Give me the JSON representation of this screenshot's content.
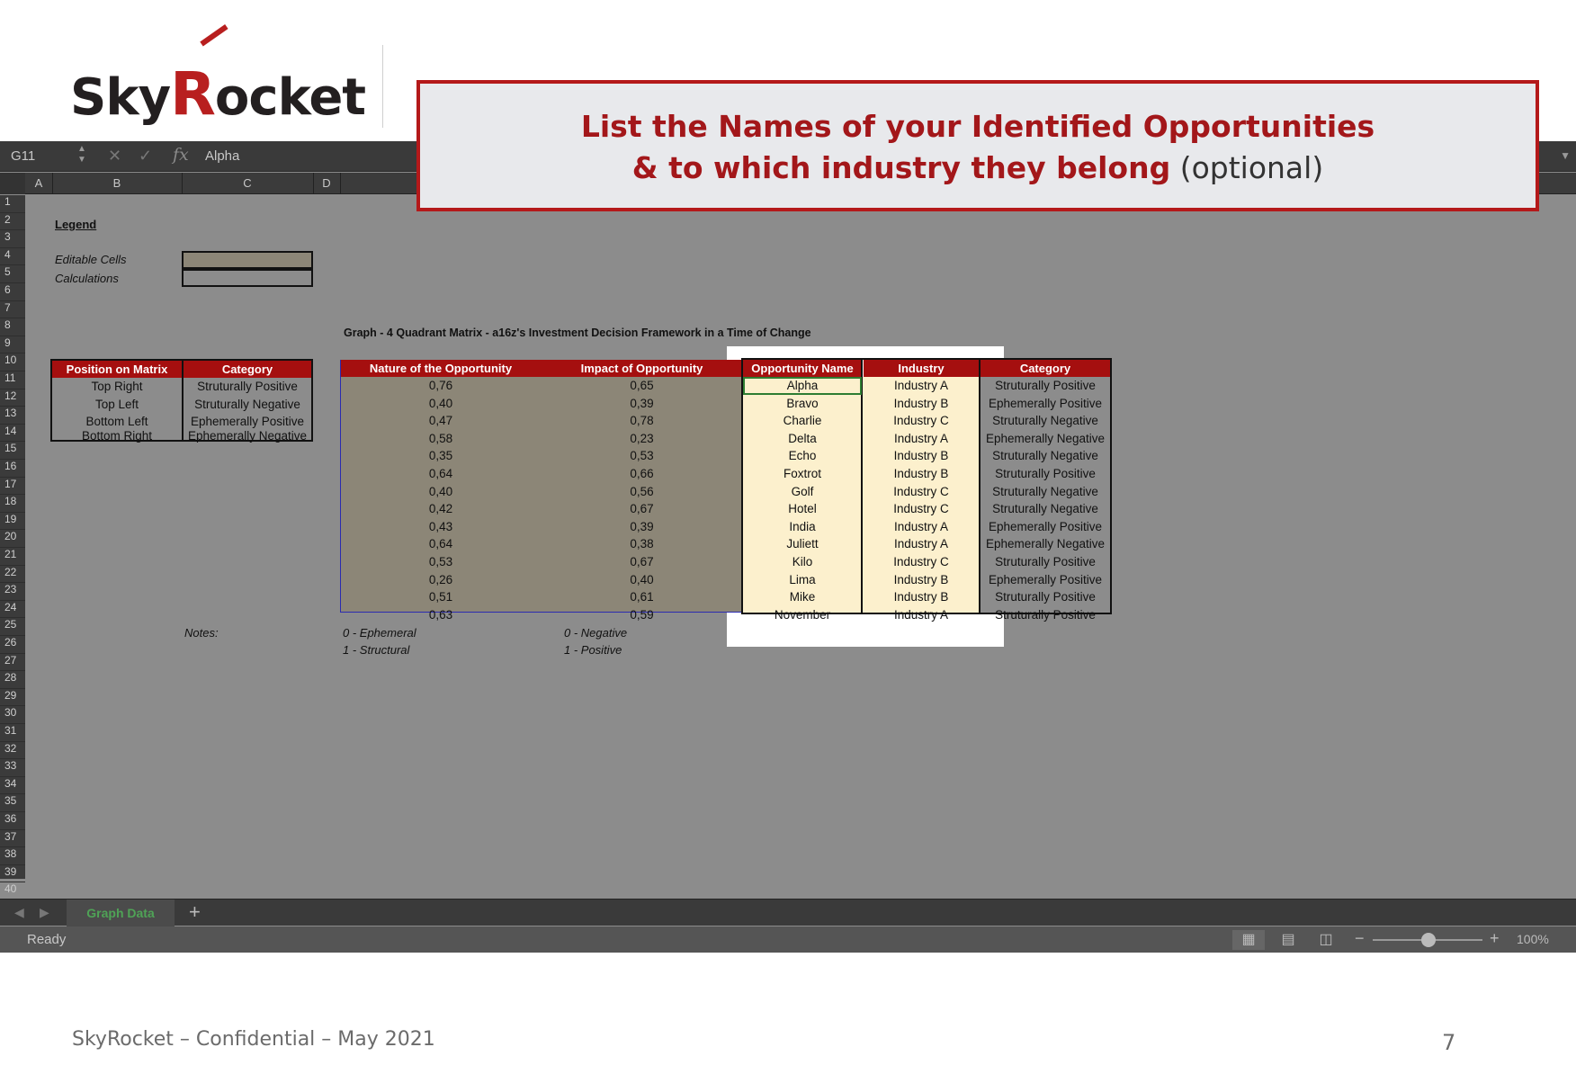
{
  "logo": {
    "text_sky": "Sky",
    "text_r": "R",
    "text_rest": "ocket"
  },
  "callout": {
    "line1": "List the Names of your Identified Opportunities",
    "line2_bold": "& to which industry they belong",
    "line2_optional": "(optional)"
  },
  "formula_bar": {
    "cell_ref": "G11",
    "fx": "fx",
    "value": "Alpha"
  },
  "columns": [
    "A",
    "B",
    "C",
    "D"
  ],
  "rows": [
    "1",
    "2",
    "3",
    "4",
    "5",
    "6",
    "7",
    "8",
    "9",
    "10",
    "11",
    "12",
    "13",
    "14",
    "15",
    "16",
    "17",
    "18",
    "19",
    "20",
    "21",
    "22",
    "23",
    "24",
    "25",
    "26",
    "27",
    "28",
    "29",
    "30",
    "31",
    "32",
    "33",
    "34",
    "35",
    "36",
    "37",
    "38",
    "39",
    "40"
  ],
  "legend": {
    "title": "Legend",
    "editable": "Editable Cells",
    "calculations": "Calculations"
  },
  "graph_title": "Graph - 4 Quadrant Matrix  - a16z's Investment Decision Framework in a Time of Change",
  "matrix_table": {
    "headers": [
      "Position on Matrix",
      "Category"
    ],
    "rows": [
      [
        "Top Right",
        "Struturally Positive"
      ],
      [
        "Top Left",
        "Struturally Negative"
      ],
      [
        "Bottom Left",
        "Ephemerally Positive"
      ],
      [
        "Bottom Right",
        "Ephemerally Negative"
      ]
    ]
  },
  "data_table": {
    "headers": [
      "Nature of the Opportunity",
      "Impact of Opportunity",
      "Opportunity Name",
      "Industry",
      "Category"
    ],
    "rows": [
      [
        "0,76",
        "0,65",
        "Alpha",
        "Industry A",
        "Struturally Positive"
      ],
      [
        "0,40",
        "0,39",
        "Bravo",
        "Industry B",
        "Ephemerally Positive"
      ],
      [
        "0,47",
        "0,78",
        "Charlie",
        "Industry C",
        "Struturally Negative"
      ],
      [
        "0,58",
        "0,23",
        "Delta",
        "Industry A",
        "Ephemerally Negative"
      ],
      [
        "0,35",
        "0,53",
        "Echo",
        "Industry B",
        "Struturally Negative"
      ],
      [
        "0,64",
        "0,66",
        "Foxtrot",
        "Industry B",
        "Struturally Positive"
      ],
      [
        "0,40",
        "0,56",
        "Golf",
        "Industry C",
        "Struturally Negative"
      ],
      [
        "0,42",
        "0,67",
        "Hotel",
        "Industry C",
        "Struturally Negative"
      ],
      [
        "0,43",
        "0,39",
        "India",
        "Industry A",
        "Ephemerally Positive"
      ],
      [
        "0,64",
        "0,38",
        "Juliett",
        "Industry A",
        "Ephemerally Negative"
      ],
      [
        "0,53",
        "0,67",
        "Kilo",
        "Industry C",
        "Struturally Positive"
      ],
      [
        "0,26",
        "0,40",
        "Lima",
        "Industry B",
        "Ephemerally Positive"
      ],
      [
        "0,51",
        "0,61",
        "Mike",
        "Industry B",
        "Struturally Positive"
      ],
      [
        "0,63",
        "0,59",
        "November",
        "Industry A",
        "Struturally Positive"
      ]
    ]
  },
  "notes": {
    "label": "Notes:",
    "nature_0": "0 - Ephemeral",
    "nature_1": "1 - Structural",
    "impact_0": "0 - Negative",
    "impact_1": "1 - Positive"
  },
  "sheet_tab": "Graph Data",
  "add_sheet": "+",
  "status": "Ready",
  "zoom": "100%",
  "footer": "SkyRocket – Confidential – May 2021",
  "page_number": "7",
  "colors": {
    "header_red": "#a50f0f",
    "editable_fill": "#8c8677",
    "opportunity_fill": "#fcf0cd",
    "callout_border": "#b4191a"
  }
}
